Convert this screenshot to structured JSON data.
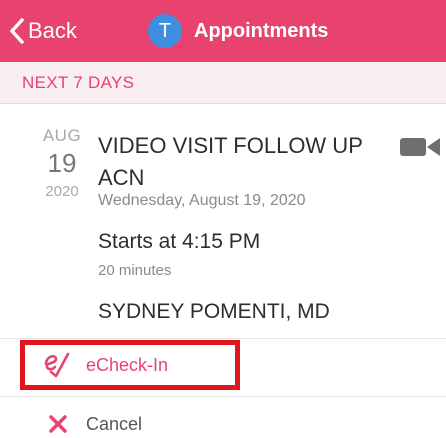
{
  "navbar": {
    "back_label": "Back",
    "avatar_initial": "T",
    "title": "Appointments",
    "color": "#e8436f"
  },
  "section": {
    "header": "NEXT 7 DAYS"
  },
  "appointment": {
    "month": "AUG",
    "day": "19",
    "year": "2020",
    "title": "VIDEO VISIT FOLLOW UP ACN",
    "date_long": "Wednesday, August 19, 2020",
    "start": "Starts at 4:15 PM",
    "duration": "20 minutes",
    "provider": "SYDNEY POMENTI, MD",
    "type_icon": "video-camera-icon"
  },
  "actions": {
    "echeckin_label": "eCheck-In",
    "cancel_label": "Cancel",
    "highlight_color": "#e2151c"
  }
}
